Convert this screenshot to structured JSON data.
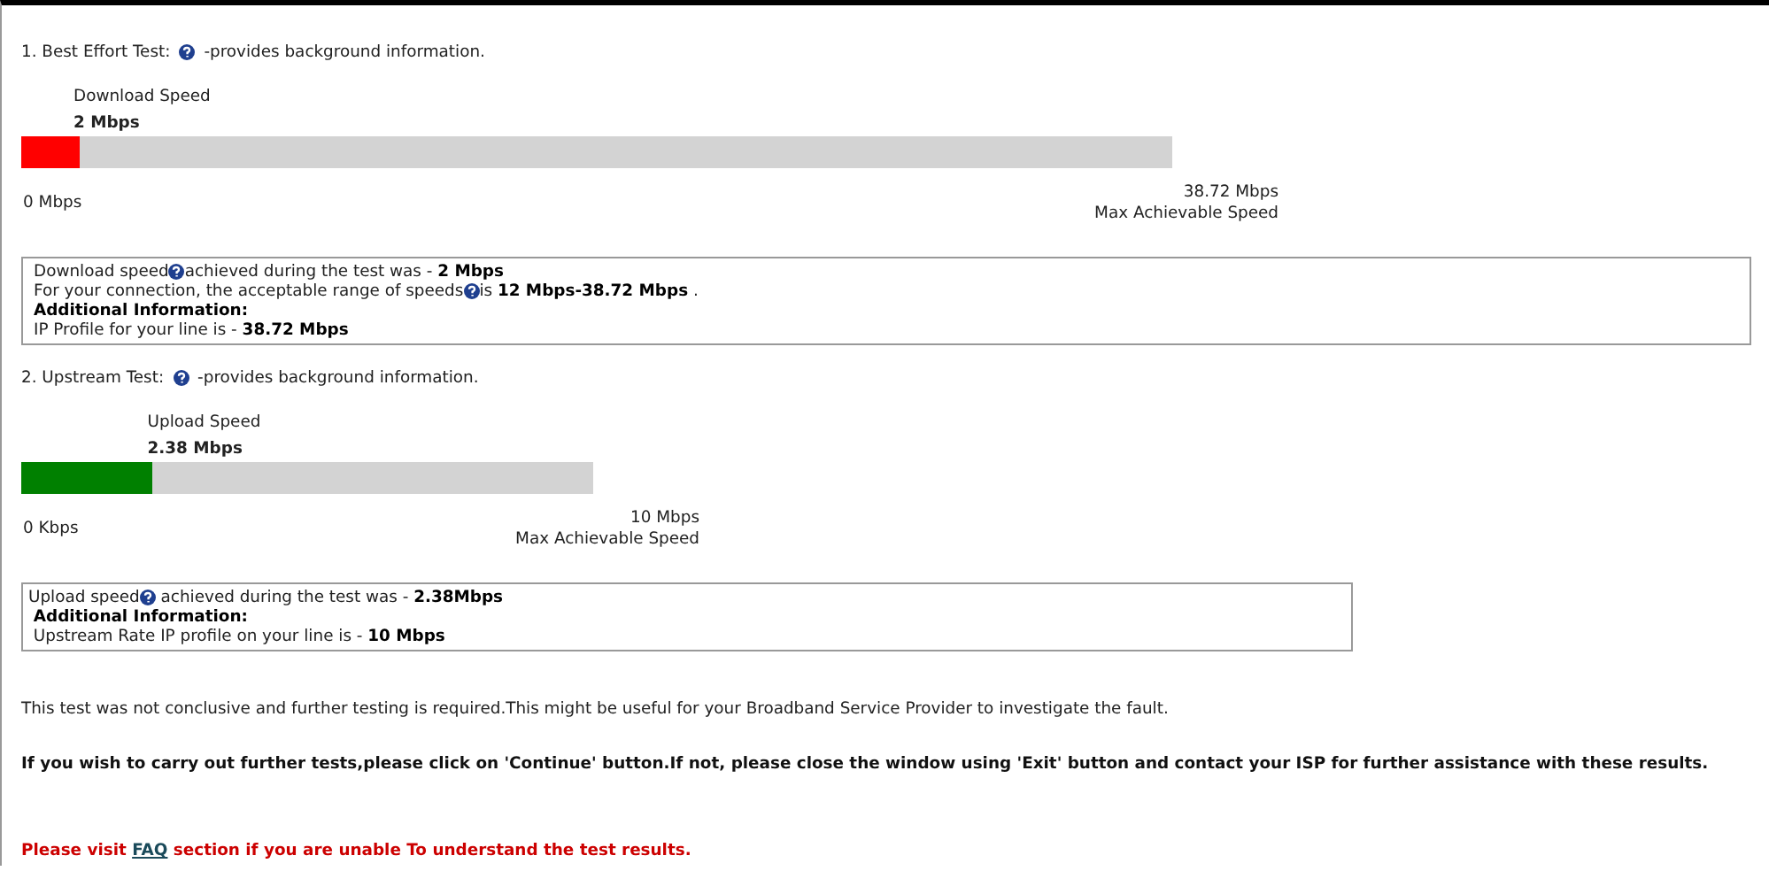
{
  "tests": [
    {
      "heading": "1. Best Effort Test:",
      "heading_note": "-provides background information.",
      "meter_label": "Download Speed",
      "value": "2 Mbps",
      "level": 0.05,
      "color": "#ff0000",
      "scale_min": "0 Mbps",
      "scale_max": "38.72 Mbps",
      "scale_caption": "Max Achievable Speed",
      "lines": [
        {
          "parts": [
            "Download speed",
            "achieved during the test was - **2 Mbps**"
          ]
        },
        {
          "parts": [
            "For your connection, the acceptable range of speeds",
            "is **12 Mbps-38.72 Mbps** ."
          ]
        },
        {
          "parts": [
            "**Additional Information:**"
          ]
        },
        {
          "parts": [
            "IP Profile for your line is - **38.72 Mbps**"
          ]
        }
      ]
    },
    {
      "heading": "2. Upstream Test:",
      "heading_note": "-provides background information.",
      "meter_label": "Upload Speed",
      "value": "2.38 Mbps",
      "level": 0.23,
      "color": "#008000",
      "scale_min": "0 Kbps",
      "scale_max": "10 Mbps",
      "scale_caption": "Max Achievable Speed",
      "lines": [
        {
          "parts": [
            "Upload speed",
            " achieved during the test was - **2.38Mbps**"
          ]
        },
        {
          "parts": [
            " **Additional Information:**"
          ]
        },
        {
          "parts": [
            " Upstream Rate IP profile on your line is - **10 Mbps**"
          ]
        }
      ]
    }
  ],
  "note": "This test was not conclusive and further testing is required.This might be useful for your Broadband Service Provider to investigate the fault.",
  "instruction": "If you wish to carry out further tests,please click on 'Continue' button.If not, please close the window using 'Exit' button and contact your ISP for further assistance with these results.",
  "footer": {
    "before": "Please visit ",
    "link": "FAQ",
    "after": " section if you are unable To understand the test results."
  }
}
